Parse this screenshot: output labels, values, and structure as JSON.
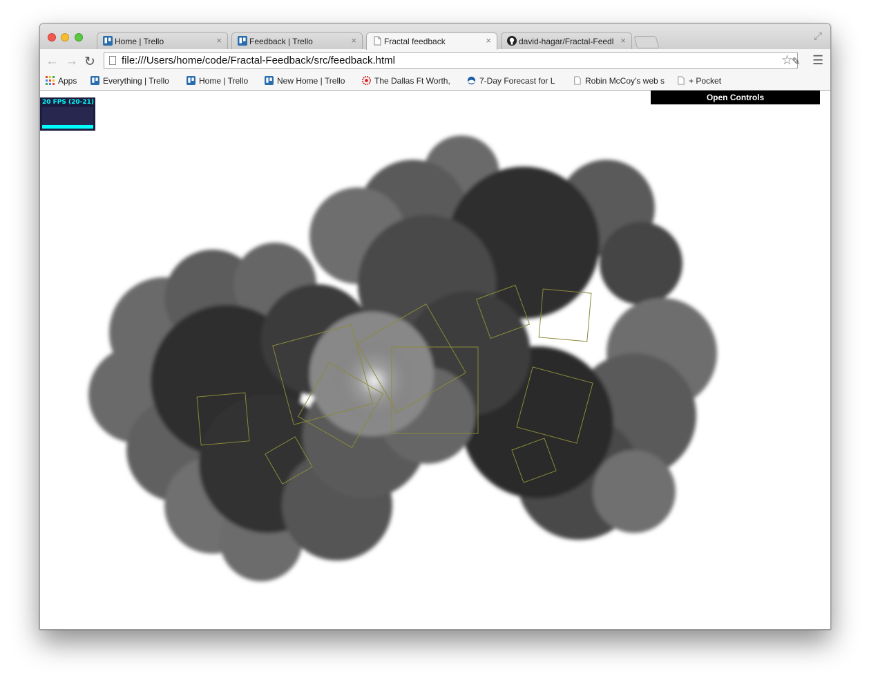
{
  "browser": {
    "tabs": [
      {
        "title": "Home | Trello",
        "icon": "trello-icon",
        "active": false
      },
      {
        "title": "Feedback | Trello",
        "icon": "trello-icon",
        "active": false
      },
      {
        "title": "Fractal feedback",
        "icon": "page-icon",
        "active": true
      },
      {
        "title": "david-hagar/Fractal-Feedl",
        "icon": "github-icon",
        "active": false
      }
    ],
    "tab_close": "×",
    "url": "file:///Users/home/code/Fractal-Feedback/src/feedback.html",
    "bookmarks": [
      {
        "label": "Apps",
        "icon": "apps-grid-icon"
      },
      {
        "label": "Everything | Trello",
        "icon": "trello-icon"
      },
      {
        "label": "Home | Trello",
        "icon": "trello-icon"
      },
      {
        "label": "New Home | Trello",
        "icon": "trello-icon"
      },
      {
        "label": "The Dallas Ft Worth,",
        "icon": "gear-icon"
      },
      {
        "label": "7-Day Forecast for L",
        "icon": "noaa-icon"
      },
      {
        "label": "Robin McCoy's web s",
        "icon": "page-icon"
      },
      {
        "label": "+ Pocket",
        "icon": "page-icon"
      }
    ]
  },
  "page": {
    "stats_fps": "20 FPS (20-21)",
    "controls_label": "Open Controls"
  },
  "colors": {
    "accent_cyan": "#00ffff",
    "stats_bg": "#1c1c3e",
    "square_outline": "#8a8a3a",
    "trello_blue": "#2a6dad"
  }
}
